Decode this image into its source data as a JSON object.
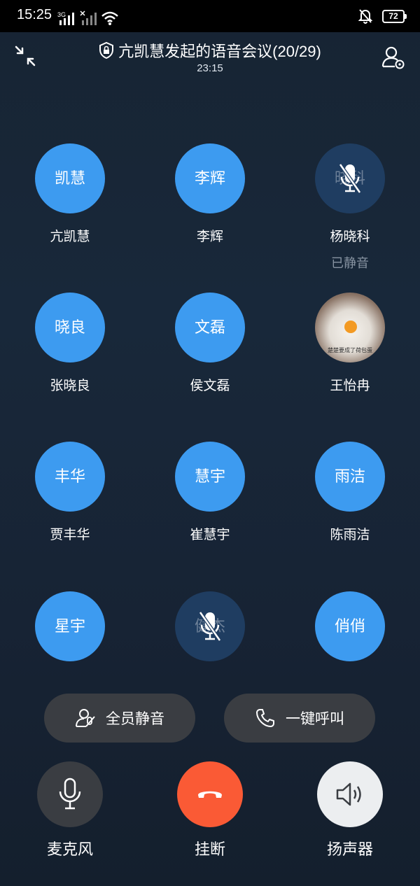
{
  "status_bar": {
    "time": "15:25",
    "network_1": "3G",
    "battery": "72"
  },
  "header": {
    "title": "亢凯慧发起的语音会议(20/29)",
    "timer": "23:15"
  },
  "participants": [
    {
      "avatar_text": "凯慧",
      "name": "亢凯慧",
      "muted": false
    },
    {
      "avatar_text": "李辉",
      "name": "李辉",
      "muted": false
    },
    {
      "avatar_text": "晓科",
      "name": "杨晓科",
      "muted": true,
      "status": "已静音"
    },
    {
      "avatar_text": "晓良",
      "name": "张晓良",
      "muted": false
    },
    {
      "avatar_text": "文磊",
      "name": "侯文磊",
      "muted": false
    },
    {
      "avatar_text": "",
      "name": "王怡冉",
      "muted": false,
      "photo": true,
      "photo_caption": "楚楚要成了荷包蛋"
    },
    {
      "avatar_text": "丰华",
      "name": "贾丰华",
      "muted": false
    },
    {
      "avatar_text": "慧宇",
      "name": "崔慧宇",
      "muted": false
    },
    {
      "avatar_text": "雨洁",
      "name": "陈雨洁",
      "muted": false
    },
    {
      "avatar_text": "星宇",
      "name": "",
      "muted": false
    },
    {
      "avatar_text": "健杰",
      "name": "",
      "muted": true
    },
    {
      "avatar_text": "俏俏",
      "name": "",
      "muted": false
    }
  ],
  "actions": {
    "mute_all": "全员静音",
    "call_all": "一键呼叫"
  },
  "controls": {
    "mic": "麦克风",
    "hangup": "挂断",
    "speaker": "扬声器"
  },
  "colors": {
    "avatar_blue": "#3d9bf0",
    "muted_avatar": "#1f3d61",
    "hangup_red": "#fa5a35",
    "pill_bg": "#3a3d42"
  }
}
